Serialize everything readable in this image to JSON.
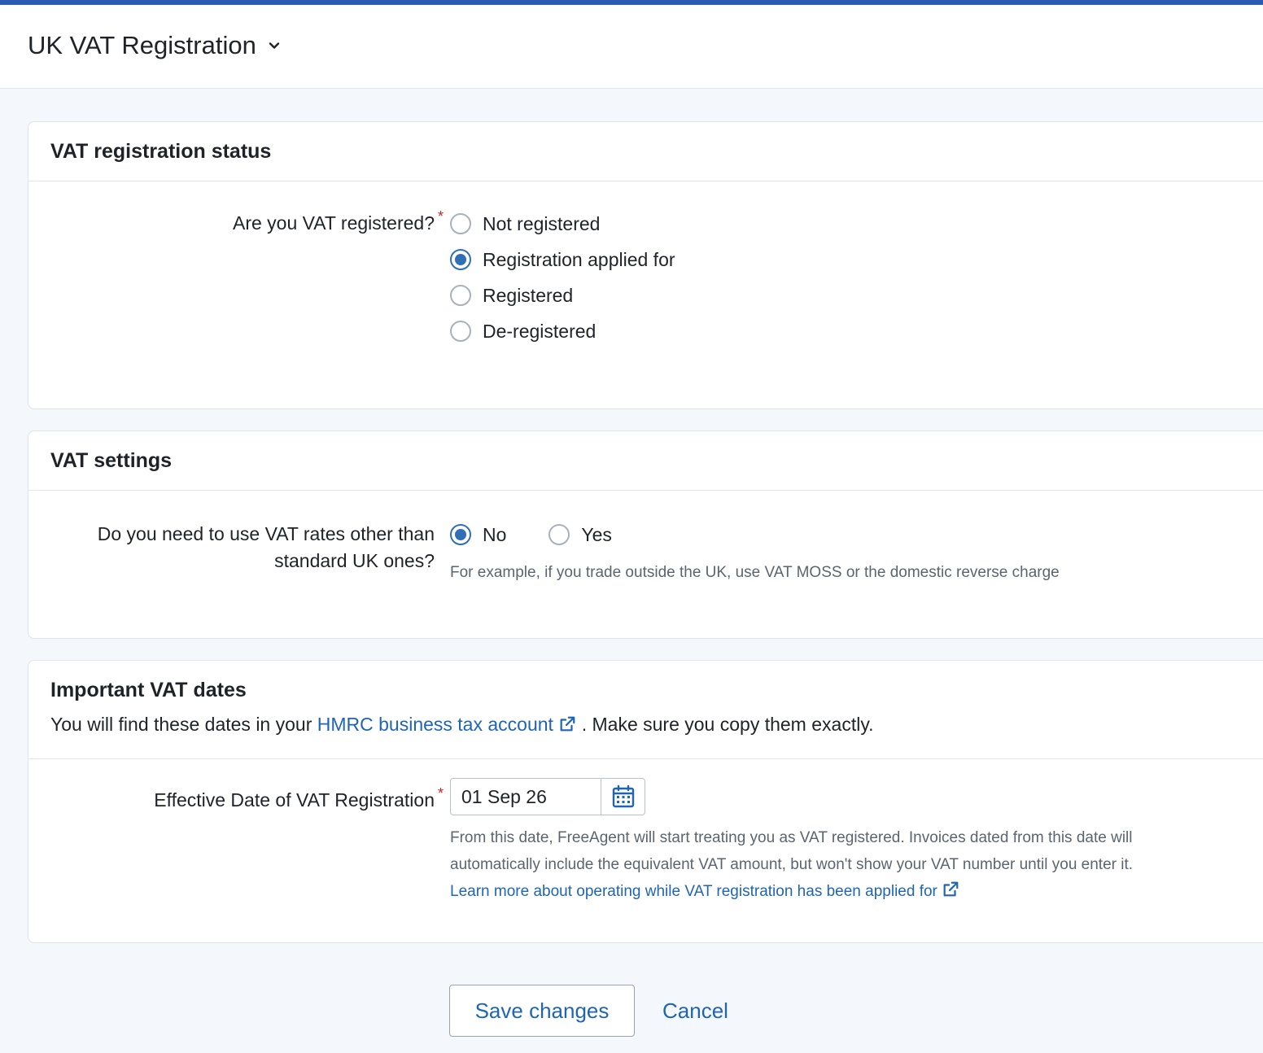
{
  "header": {
    "title": "UK VAT Registration"
  },
  "colors": {
    "accent": "#1f65b5",
    "topbar": "#2b59b6",
    "required": "#c62828",
    "radio_selected": "#2f6fb8"
  },
  "status_card": {
    "title": "VAT registration status",
    "question": "Are you VAT registered?",
    "required_mark": "*",
    "options": [
      {
        "label": "Not registered",
        "selected": false
      },
      {
        "label": "Registration applied for",
        "selected": true
      },
      {
        "label": "Registered",
        "selected": false
      },
      {
        "label": "De-registered",
        "selected": false
      }
    ]
  },
  "settings_card": {
    "title": "VAT settings",
    "question_line1": "Do you need to use VAT rates other than",
    "question_line2": "standard UK ones?",
    "options": [
      {
        "label": "No",
        "selected": true
      },
      {
        "label": "Yes",
        "selected": false
      }
    ],
    "hint": "For example, if you trade outside the UK, use VAT MOSS or the domestic reverse charge"
  },
  "dates_card": {
    "title": "Important VAT dates",
    "intro_before": "You will find these dates in your",
    "intro_link": "HMRC business tax account",
    "intro_after": ". Make sure you copy them exactly.",
    "field_label": "Effective Date of VAT Registration",
    "required_mark": "*",
    "date_value": "01 Sep 26",
    "help_line1": "From this date, FreeAgent will start treating you as VAT registered. Invoices dated from this date will",
    "help_line2": "automatically include the equivalent VAT amount, but won't show your VAT number until you enter it.",
    "learn_more_link": "Learn more about operating while VAT registration has been applied for"
  },
  "actions": {
    "save_label": "Save changes",
    "cancel_label": "Cancel"
  }
}
